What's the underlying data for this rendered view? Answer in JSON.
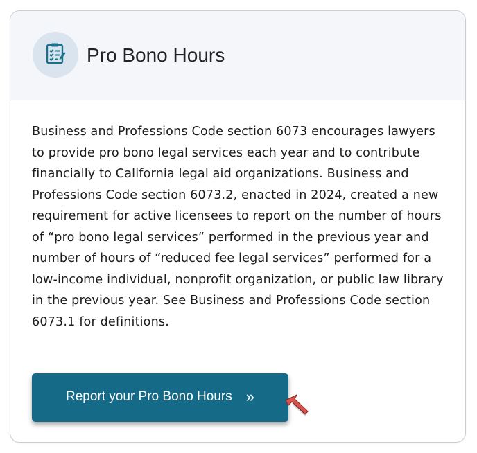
{
  "card": {
    "title": "Pro Bono Hours",
    "icon": "clipboard-checklist-icon",
    "body": "Business and Professions Code section 6073 encourages lawyers to provide pro bono legal services each year and to contribute financially to California legal aid organizations. Business and Professions Code section 6073.2, enacted in 2024, created a new requirement for active licensees to report on the number of hours of “pro bono legal services” performed in the previous year and number of hours of “reduced fee legal services” performed for a low-income individual, nonprofit organization, or public law library in the previous year. See Business and Professions Code section 6073.1 for definitions.",
    "button_label": "Report your Pro Bono Hours",
    "button_chevron": "»"
  },
  "colors": {
    "header_bg": "#f4f6f9",
    "icon_circle_bg": "#d9e4ee",
    "icon_color": "#1b6f8a",
    "button_bg": "#156a87",
    "cursor": "#d9534f"
  }
}
